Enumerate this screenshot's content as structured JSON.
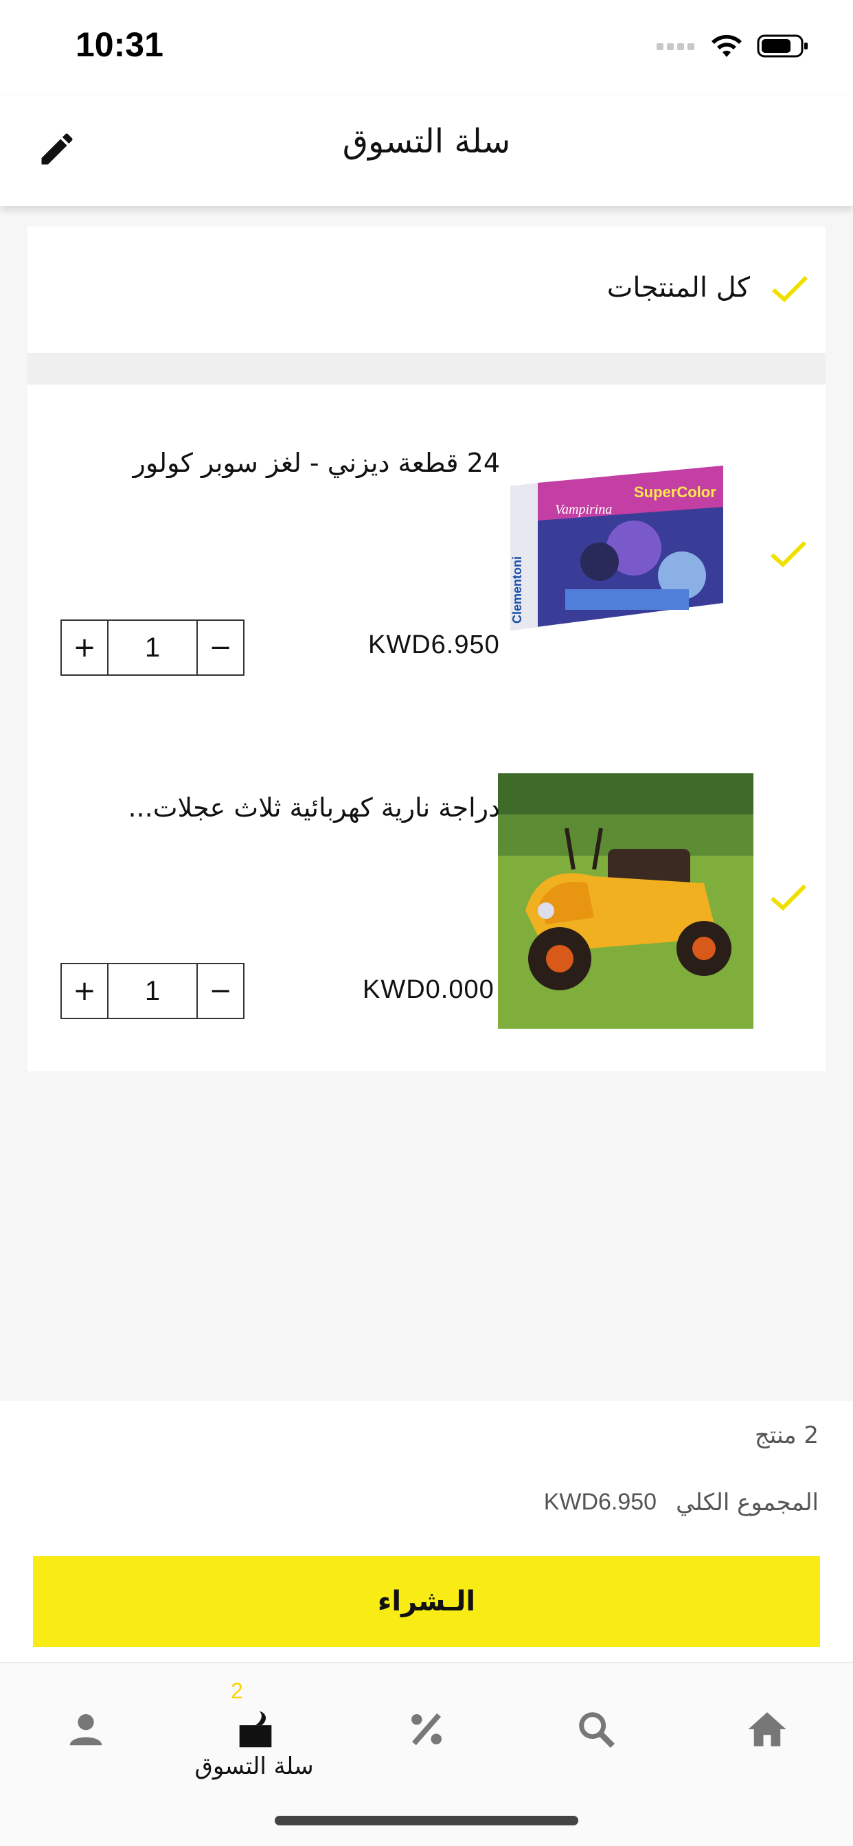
{
  "status_bar": {
    "time": "10:31"
  },
  "header": {
    "title": "سلة التسوق"
  },
  "select_all": {
    "label": "كل المنتجات",
    "checked": true
  },
  "items": [
    {
      "title": "24 قطعة ديزني - لغز سوبر كولور",
      "price": "KWD6.950",
      "quantity": "1",
      "checked": true,
      "image": "puzzle-box-image"
    },
    {
      "title": "دراجة نارية كهربائية ثلاث عجلات...",
      "price": "KWD0.000",
      "quantity": "1",
      "checked": true,
      "image": "electric-tricycle-image"
    }
  ],
  "stepper": {
    "plus": "+",
    "minus": "−"
  },
  "summary": {
    "count_label": "2 منتج",
    "total_label": "المجموع الكلي",
    "total_value": "KWD6.950",
    "buy_label": "الـشراء"
  },
  "tabbar": {
    "cart_label": "سلة التسوق",
    "cart_badge": "2",
    "icons": [
      "person-icon",
      "cart-icon",
      "percent-icon",
      "search-icon",
      "home-icon"
    ]
  },
  "colors": {
    "accent": "#f8ec14",
    "check": "#f0e000"
  }
}
